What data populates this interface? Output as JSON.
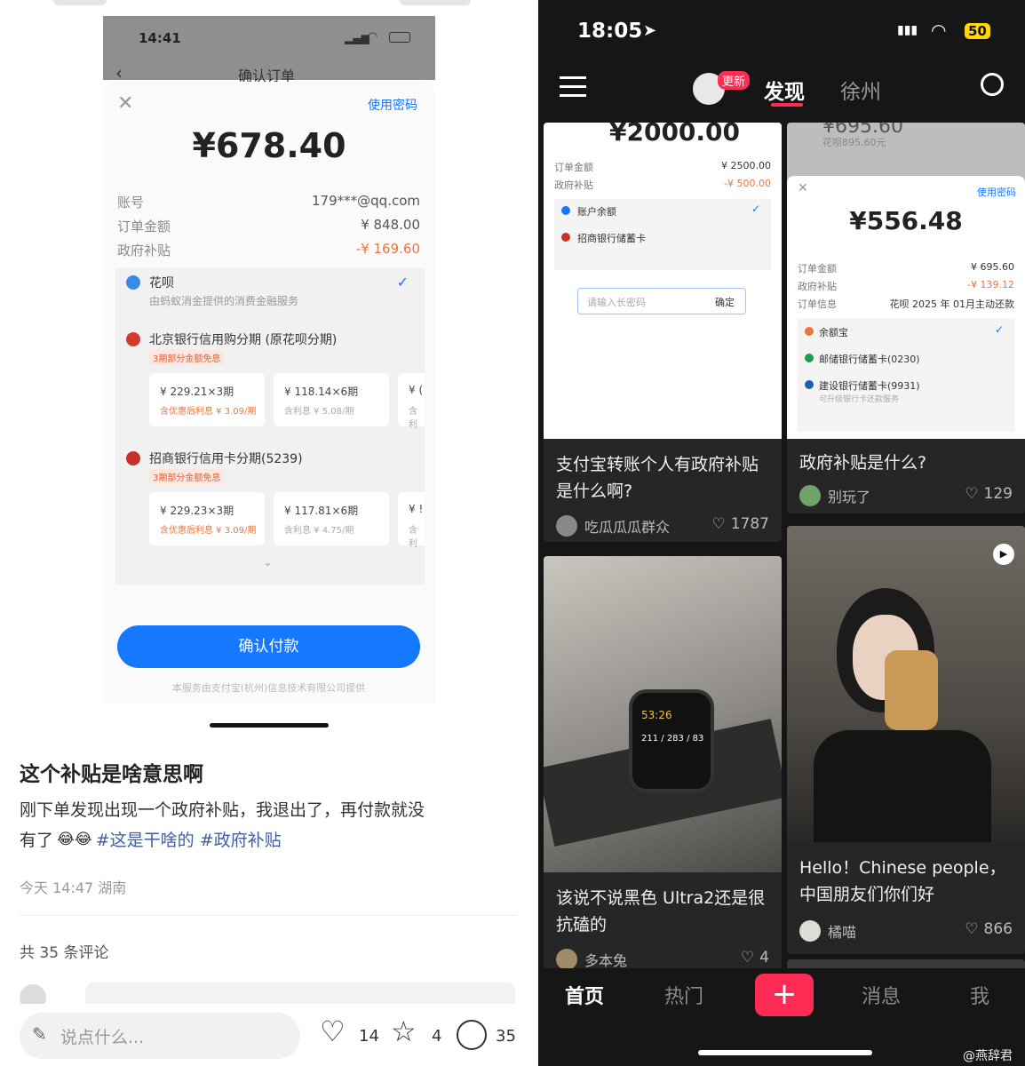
{
  "left": {
    "status_time": "14:41",
    "nav_title": "确认订单",
    "use_password": "使用密码",
    "amount": "¥678.40",
    "account_label": "账号",
    "account_value": "179***@qq.com",
    "order_label": "订单金额",
    "order_value": "¥ 848.00",
    "subsidy_label": "政府补贴",
    "subsidy_value": "-¥ 169.60",
    "huabei_title": "花呗",
    "huabei_desc": "由蚂蚁消金提供的消费金融服务",
    "bj_title": "北京银行信用购分期 (原花呗分期)",
    "bj_tag": "3期部分金额免息",
    "bj_inst1_a": "¥ 229.21×3期",
    "bj_inst1_b": "含优惠后利息 ¥ 3.09/期",
    "bj_inst2_a": "¥ 118.14×6期",
    "bj_inst2_b": "含利息 ¥ 5.08/期",
    "bj_inst3_a": "¥ (",
    "bj_inst3_b": "含利",
    "cmb_title": "招商银行信用卡分期(5239)",
    "cmb_tag": "3期部分金额免息",
    "cmb_inst1_a": "¥ 229.23×3期",
    "cmb_inst1_b": "含优惠后利息 ¥ 3.09/期",
    "cmb_inst2_a": "¥ 117.81×6期",
    "cmb_inst2_b": "含利息 ¥ 4.75/期",
    "cmb_inst3_a": "¥ !",
    "cmb_inst3_b": "含利",
    "confirm_pay": "确认付款",
    "service_note": "本服务由支付宝(杭州)信息技术有限公司提供",
    "post_title": "这个补贴是啥意思啊",
    "post_body_1": "刚下单发现出现一个政府补贴，我退出了，再付款就没",
    "post_body_2": "有了",
    "post_tags": "#这是干啥的 #政府补贴",
    "post_meta": "今天 14:47 湖南",
    "comment_count": "共 35 条评论",
    "comment_placeholder": "说点什么...",
    "likes": "14",
    "stars": "4",
    "comments": "35"
  },
  "right": {
    "status_time": "18:05",
    "battery": "50",
    "update_badge": "更新",
    "tab_discover": "发现",
    "tab_city": "徐州",
    "card1": {
      "amount": "¥2000.00",
      "order_label": "订单金额",
      "order_value": "¥ 2500.00",
      "subsidy_label": "政府补贴",
      "subsidy_value": "-¥ 500.00",
      "opt1": "账户余额",
      "opt2": "招商银行储蓄卡",
      "pwd_placeholder": "请输入长密码",
      "confirm": "确定",
      "title": "支付宝转账个人有政府补贴是什么啊?",
      "user": "吃瓜瓜瓜群众",
      "likes": "1787"
    },
    "card2": {
      "top_amount": "¥695.60",
      "top_note": "花呗895.60元",
      "use_password": "使用密码",
      "amount": "¥556.48",
      "order_label": "订单金额",
      "order_value": "¥ 695.60",
      "subsidy_label": "政府补贴",
      "subsidy_value": "-¥ 139.12",
      "info_label": "订单信息",
      "info_value": "花呗 2025 年 01月主动还款",
      "opt1": "余额宝",
      "opt2": "邮储银行储蓄卡(0230)",
      "opt3": "建设银行储蓄卡(9931)",
      "opt3_note": "可升级银行卡还款服务",
      "title": "政府补贴是什么?",
      "user": "别玩了",
      "likes": "129"
    },
    "card3": {
      "watch_time": "53:26",
      "watch_stats": "211 / 283 / 83",
      "title": "该说不说黑色 Ultra2还是很抗磕的",
      "user": "多本兔",
      "likes": "4"
    },
    "card4": {
      "title": "Hello！Chinese people，中国朋友们你们好",
      "user": "橘喵",
      "likes": "866"
    },
    "nav_home": "首页",
    "nav_hot": "热门",
    "nav_add": "+",
    "nav_msg": "消息",
    "nav_me": "我"
  },
  "watermark": "@燕辞君"
}
